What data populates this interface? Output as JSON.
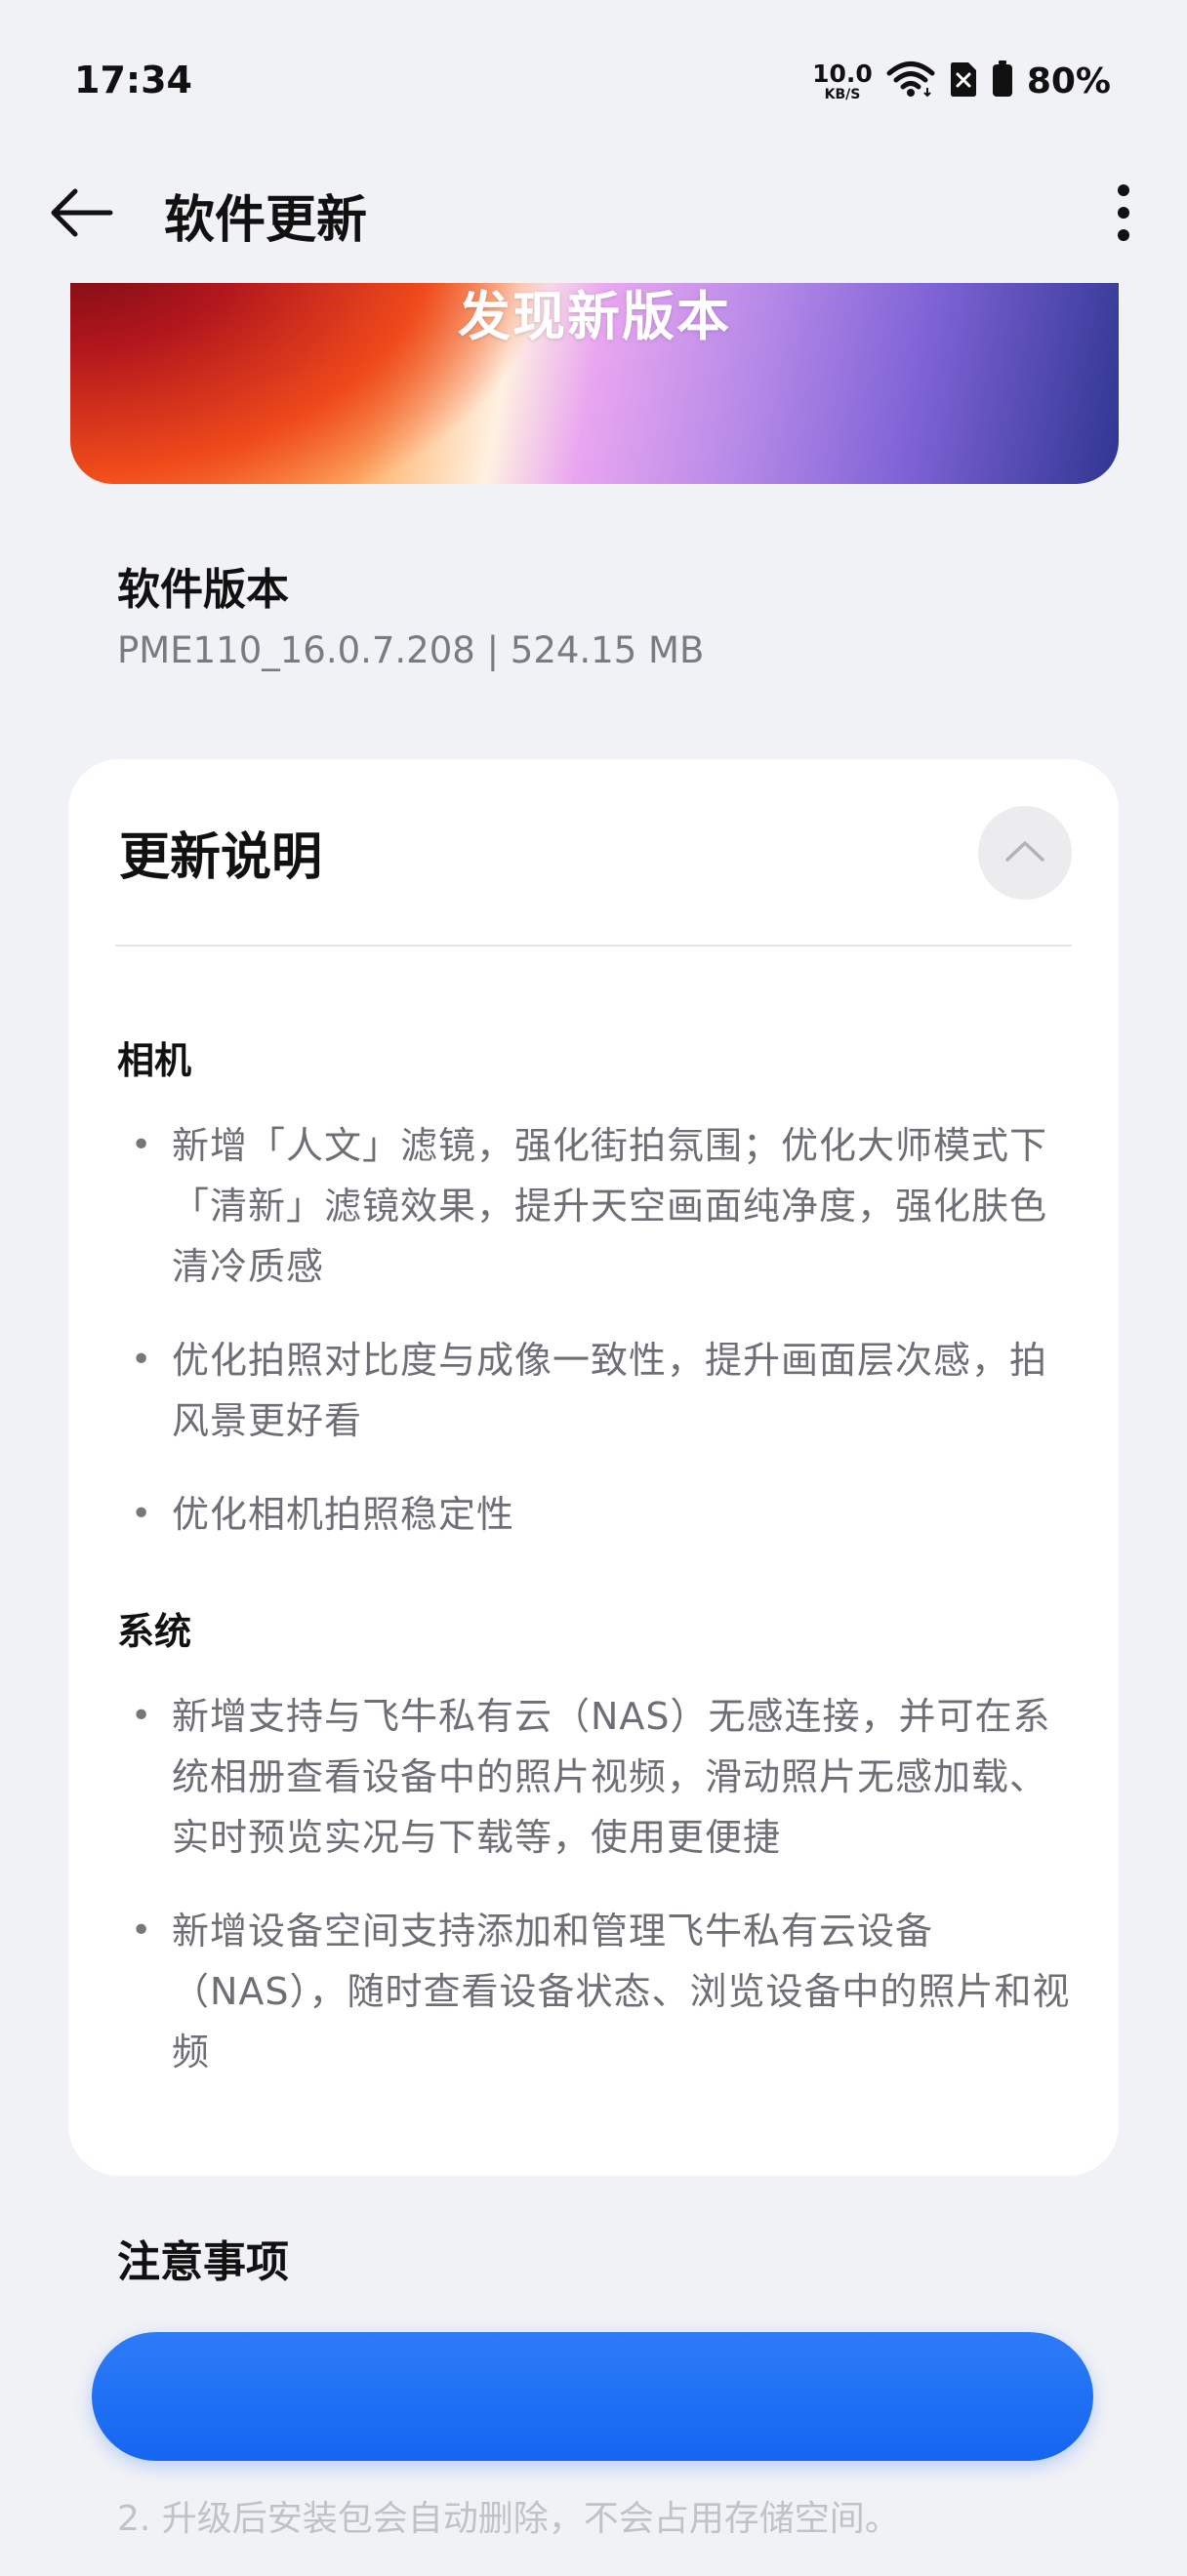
{
  "status_bar": {
    "time": "17:34",
    "net_speed_value": "10.0",
    "net_speed_unit": "KB/S",
    "battery": "80%",
    "icons": [
      "net-speed",
      "wifi-icon",
      "sim-disabled-icon",
      "battery-icon"
    ]
  },
  "header": {
    "title": "软件更新",
    "back_icon": "arrow-left-icon",
    "more_icon": "more-vertical-icon"
  },
  "banner": {
    "title": "发现新版本"
  },
  "version": {
    "title": "软件版本",
    "detail": "PME110_16.0.7.208 | 524.15 MB"
  },
  "update_notes": {
    "title": "更新说明",
    "collapse_icon": "chevron-up-icon",
    "sections": [
      {
        "heading": "相机",
        "items": [
          "新增「人文」滤镜，强化街拍氛围；优化大师模式下「清新」滤镜效果，提升天空画面纯净度，强化肤色清冷质感",
          "优化拍照对比度与成像一致性，提升画面层次感，拍风景更好看",
          "优化相机拍照稳定性"
        ]
      },
      {
        "heading": "系统",
        "items": [
          "新增支持与飞牛私有云（NAS）无感连接，并可在系统相册查看设备中的照片视频，滑动照片无感加载、实时预览实况与下载等，使用更便捷",
          "新增设备空间支持添加和管理飞牛私有云设备（NAS），随时查看设备状态、浏览设备中的照片和视频"
        ]
      }
    ]
  },
  "notes": {
    "title": "注意事项",
    "line2": "2. 升级后安装包会自动删除，不会占用存储空间。"
  },
  "colors": {
    "background": "#f1f2f6",
    "card": "#ffffff",
    "primary_button": "#1a6cf5",
    "secondary_text": "#6d6f74"
  }
}
